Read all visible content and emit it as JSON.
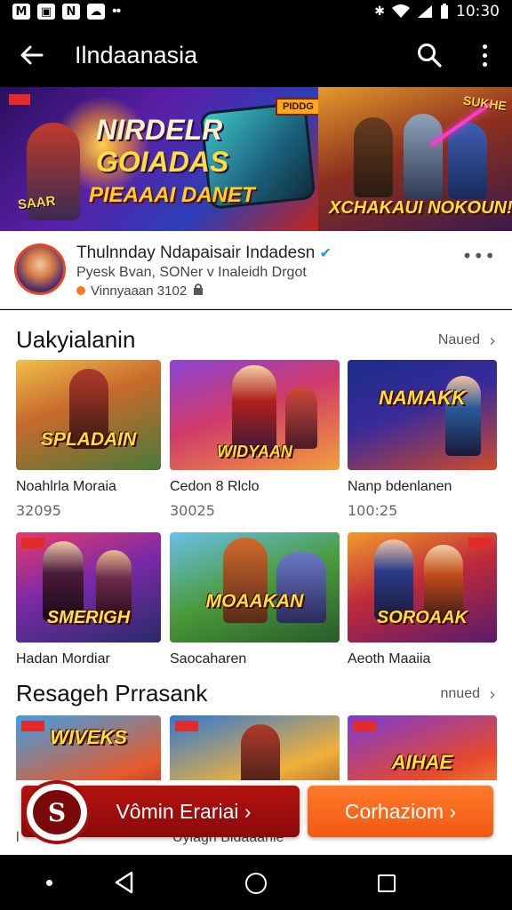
{
  "status_bar": {
    "left_icons": [
      "M",
      "▣",
      "N",
      "☁"
    ],
    "overflow": "••",
    "bluetooth": "✱",
    "signal": "▲",
    "time": "10:30"
  },
  "app_bar": {
    "title": "Ilndaanasia"
  },
  "banner": {
    "left_title_1": "NIRDELR",
    "left_title_2": "GOIADAS",
    "left_subtitle": "PIEAAAI DANET",
    "left_badge": "SAAR",
    "left_tag": "PIDDG",
    "right_tag": "SUKHE",
    "right_title": "XCHAKAUI NOKOUN!"
  },
  "profile": {
    "name": "Thulnnday Ndapaisair Indadesn",
    "verified": "✔",
    "subtitle": "Pyesk Bvan, SONer v Inaleidh Drgot",
    "meta": "Vinnyaaan 3102",
    "more": "•••"
  },
  "sections": [
    {
      "title": "Uakyialanin",
      "more": "Naued",
      "cards": [
        {
          "title": "Noahlrla Moraia",
          "count": "32095",
          "thumb_text": "SPLADAIN"
        },
        {
          "title": "Cedon 8 Rlclo",
          "count": "30025",
          "thumb_text": "WIDYAAN"
        },
        {
          "title": "Nanp bdenlanen",
          "count": "100:25",
          "thumb_text": "NAMAKK"
        }
      ]
    },
    {
      "title": "",
      "more": "",
      "cards": [
        {
          "title": "Hadan Mordiar",
          "count": "",
          "thumb_text": "SMERIGH"
        },
        {
          "title": "Saocaharen",
          "count": "",
          "thumb_text": "MOAAKAN"
        },
        {
          "title": "Aeoth Maaiia",
          "count": "",
          "thumb_text": "SOROAAK"
        }
      ]
    },
    {
      "title": "Resageh Prrasank",
      "more": "nnued",
      "cards": [
        {
          "title": "",
          "count": "",
          "thumb_text": "WIVEKS"
        },
        {
          "title": "",
          "count": "",
          "thumb_text": ""
        },
        {
          "title": "",
          "count": "",
          "thumb_text": "AIHAE"
        }
      ]
    }
  ],
  "under_text": {
    "left": "l",
    "middle": "Uyiagn Bidaaanie"
  },
  "actions": {
    "primary_label": "Vômin Erariai ›",
    "secondary_label": "Corhaziom ›",
    "logo_glyph": "S"
  },
  "colors": {
    "primary": "#a40f0c",
    "secondary": "#f26418",
    "verified": "#2196f3"
  },
  "icons": {
    "back": "arrow-left-icon",
    "search": "search-icon",
    "more": "more-vertical-icon"
  }
}
